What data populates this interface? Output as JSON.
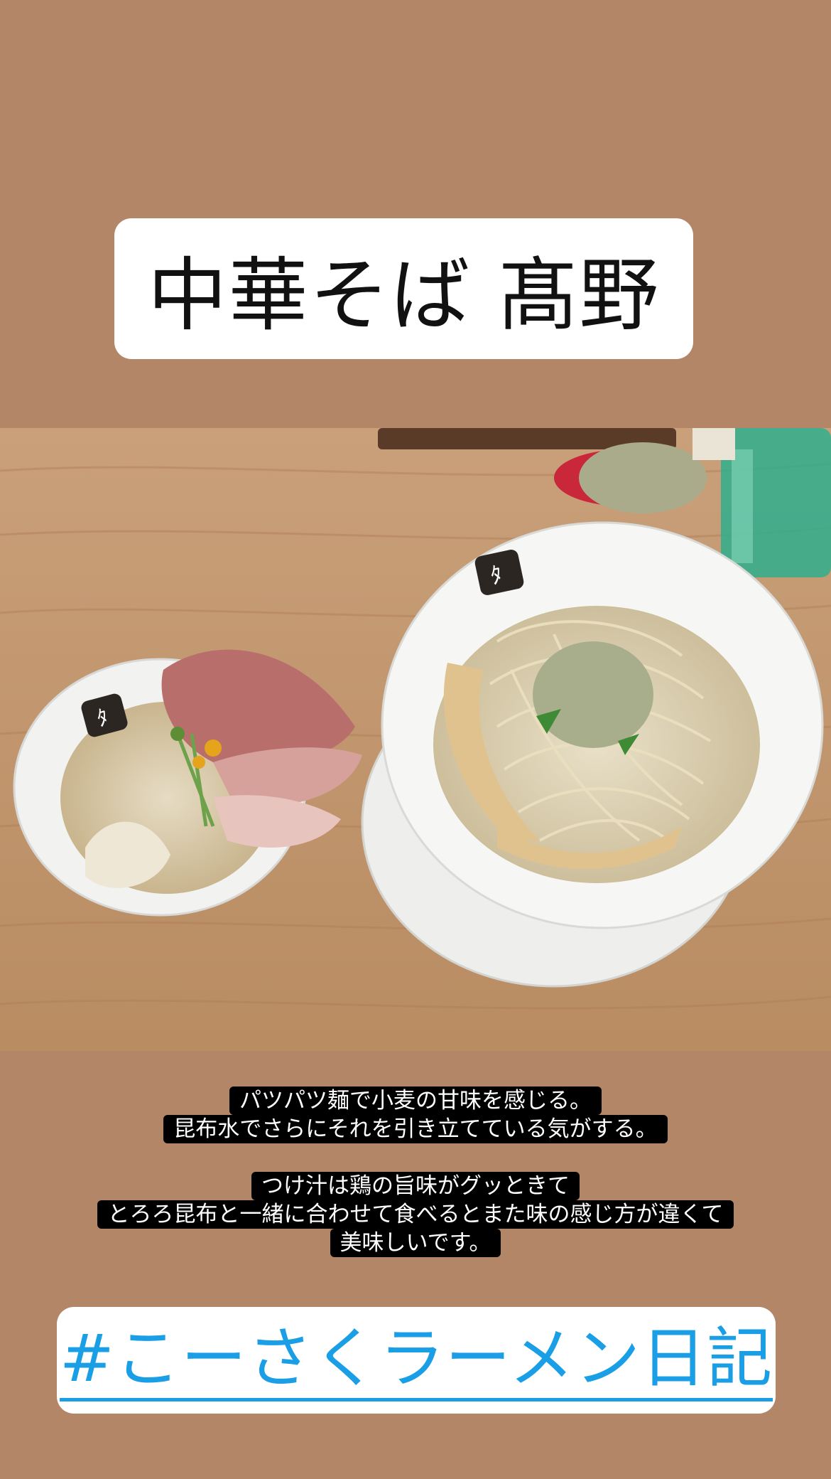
{
  "title": "中華そば 髙野",
  "captions": {
    "para1": [
      "パツパツ麺で小麦の甘味を感じる。",
      "昆布水でさらにそれを引き立てている気がする。"
    ],
    "para2": [
      "つけ汁は鶏の旨味がグッときて",
      "とろろ昆布と一緒に合わせて食べるとまた味の感じ方が違くて",
      "美味しいです。"
    ]
  },
  "hashtag": "#こーさくラーメン日記",
  "colors": {
    "background": "#b28667",
    "hashtag": "#1a9ee6"
  }
}
